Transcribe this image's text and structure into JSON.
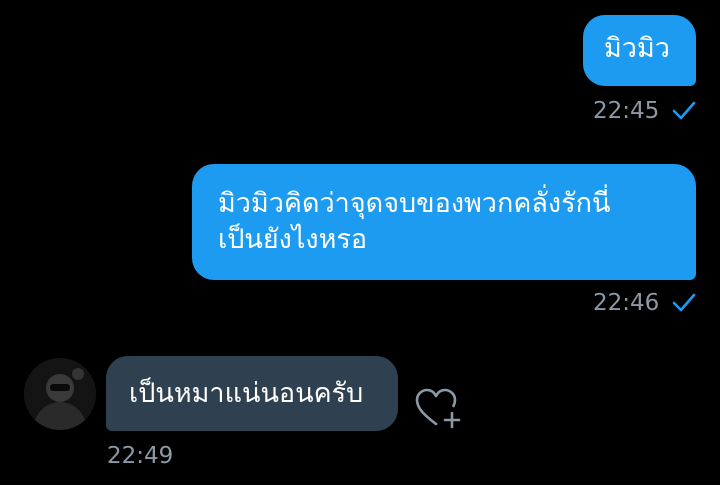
{
  "colors": {
    "background": "#000000",
    "outgoing_bubble": "#1d9bf0",
    "incoming_bubble": "#2f4050",
    "timestamp": "#8b98a5",
    "read_check": "#1d9bf0"
  },
  "messages": [
    {
      "direction": "outgoing",
      "text": "มิวมิว",
      "time": "22:45",
      "status_icon": "read-check-icon"
    },
    {
      "direction": "outgoing",
      "text": "มิวมิวคิดว่าจุดจบของพวกคลั่งรักนี่\nเป็นยังไงหรอ",
      "time": "22:46",
      "status_icon": "read-check-icon"
    },
    {
      "direction": "incoming",
      "text": "เป็นหมาแน่นอนครับ",
      "time": "22:49",
      "avatar_icon": "avatar",
      "reaction_icon": "heart-plus-icon"
    }
  ]
}
